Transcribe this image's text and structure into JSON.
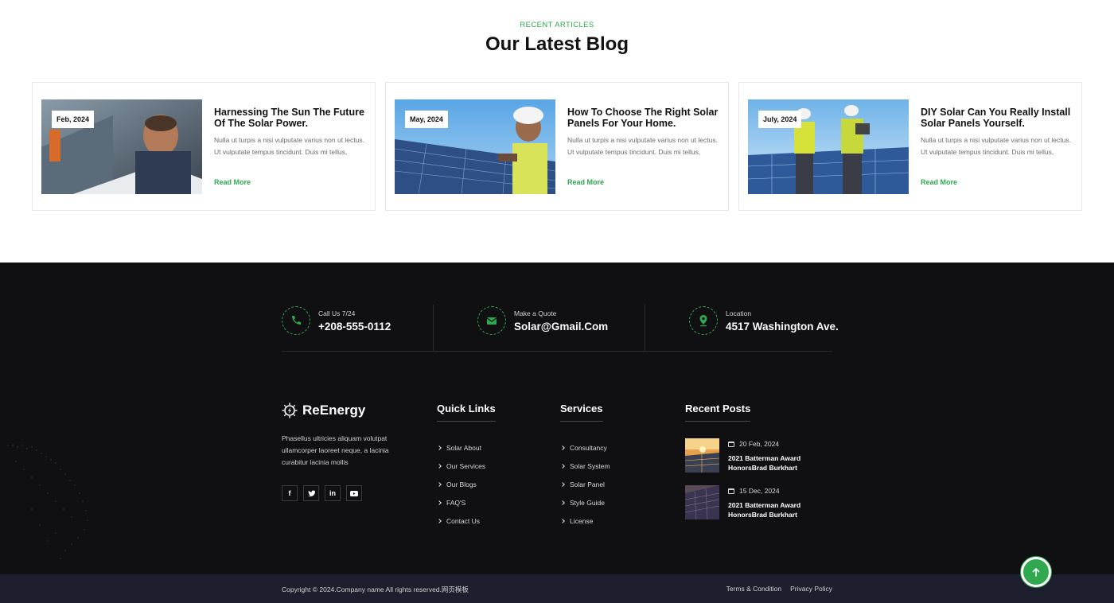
{
  "blog": {
    "eyebrow": "RECENT ARTICLES",
    "title": "Our Latest Blog",
    "cards": [
      {
        "date": "Feb, 2024",
        "title": "Harnessing The Sun The Future Of The Solar Power.",
        "text": "Nulla ut turpis a nisi vulputate varius non ut lectus. Ut vulputate tempus tincidunt. Duis mi tellus,",
        "link": "Read More"
      },
      {
        "date": "May, 2024",
        "title": "How To Choose The Right Solar Panels For Your Home.",
        "text": "Nulla ut turpis a nisi vulputate varius non ut lectus. Ut vulputate tempus tincidunt. Duis mi tellus,",
        "link": "Read More"
      },
      {
        "date": "July, 2024",
        "title": "DIY Solar Can You Really Install Solar Panels Yourself.",
        "text": "Nulla ut turpis a nisi vulputate varius non ut lectus. Ut vulputate tempus tincidunt. Duis mi tellus,",
        "link": "Read More"
      }
    ]
  },
  "contact": {
    "items": [
      {
        "label": "Call Us 7/24",
        "value": "+208-555-0112",
        "icon": "phone-icon"
      },
      {
        "label": "Make a Quote",
        "value": "Solar@Gmail.Com",
        "icon": "mail-icon"
      },
      {
        "label": "Location",
        "value": "4517 Washington Ave.",
        "icon": "location-pin-icon"
      }
    ]
  },
  "footer": {
    "brand": "ReEnergy",
    "about": "Phasellus ultricies aliquam volutpat ullamcorper laoreet neque, a lacinia curabitur lacinia mollis",
    "socials": [
      "f",
      "t",
      "in",
      "yt"
    ],
    "quick_links": {
      "title": "Quick Links",
      "items": [
        "Solar About",
        "Our Services",
        "Our Blogs",
        "FAQ'S",
        "Contact Us"
      ]
    },
    "services": {
      "title": "Services",
      "items": [
        "Consultancy",
        "Solar System",
        "Solar Panel",
        "Style Guide",
        "License"
      ]
    },
    "recent_posts": {
      "title": "Recent Posts",
      "items": [
        {
          "date": "20 Feb, 2024",
          "title": "2021 Batterman Award HonorsBrad Burkhart"
        },
        {
          "date": "15 Dec, 2024",
          "title": "2021 Batterman Award HonorsBrad Burkhart"
        }
      ]
    },
    "copyright": "Copyright © 2024.Company name All rights reserved.网页模板",
    "legal": [
      "Terms & Condition",
      "Privacy Policy"
    ]
  },
  "colors": {
    "accent": "#2fa84f",
    "footer_bg": "#101012",
    "bottom_bar": "#1e1f2e"
  }
}
